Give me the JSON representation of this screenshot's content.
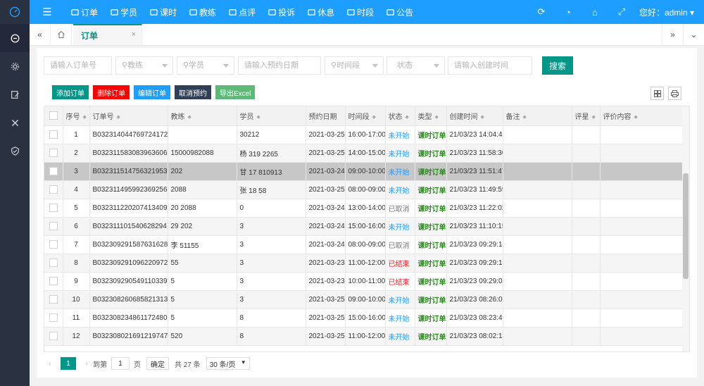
{
  "topnav": {
    "items": [
      {
        "icon": "tv-icon",
        "label": "订单"
      },
      {
        "icon": "users-icon",
        "label": "学员"
      },
      {
        "icon": "edit-icon",
        "label": "课时"
      },
      {
        "icon": "user-icon",
        "label": "教练"
      },
      {
        "icon": "thumb-icon",
        "label": "点评"
      },
      {
        "icon": "star-icon",
        "label": "投诉"
      },
      {
        "icon": "smile-icon",
        "label": "休息"
      },
      {
        "icon": "gear-icon",
        "label": "时段"
      },
      {
        "icon": "bell-icon",
        "label": "公告"
      }
    ],
    "greeting": "您好：admin"
  },
  "tabs": {
    "active": "订单"
  },
  "filters": {
    "order_no": "请输入订单号",
    "coach": "教练",
    "student": "学员",
    "date": "请输入预约日期",
    "timeslot": "时间段",
    "status": "状态",
    "created": "请输入创建时间",
    "search": "搜索"
  },
  "toolbar": {
    "add": "添加订单",
    "delete": "删除订单",
    "edit": "编辑订单",
    "cancel": "取消预约",
    "export": "导出Excel"
  },
  "colors": {
    "primary": "#009688",
    "blue": "#1e9fff",
    "red": "#ff0000",
    "dark": "#2f4056",
    "green": "#5fb878"
  },
  "table": {
    "headers": [
      "序号",
      "订单号",
      "教练",
      "学员",
      "预约日期",
      "时间段",
      "状态",
      "类型",
      "创建时间",
      "备注",
      "评星",
      "评价内容"
    ],
    "rows": [
      {
        "no": "1",
        "order": "B032314044769724172 5",
        "coach": "",
        "student": "30212",
        "date": "2021-03-25",
        "time": "16:00-17:00",
        "status": "未开始",
        "type": "课时订单",
        "created": "21/03/23 14:04:47"
      },
      {
        "no": "2",
        "order": "B032311583083963606 8",
        "coach": "15000982088",
        "student": "杨  319  2265",
        "date": "2021-03-25",
        "time": "14:00-15:00",
        "status": "未开始",
        "type": "课时订单",
        "created": "21/03/23 11:58:30"
      },
      {
        "no": "3",
        "order": "B032311514756321953 6",
        "coach": "202",
        "student": "甘  17  810913",
        "date": "2021-03-24",
        "time": "09:00-10:00",
        "status": "未开始",
        "type": "课时订单",
        "created": "21/03/23 11:51:47"
      },
      {
        "no": "4",
        "order": "B032311495992369256 0",
        "coach": "2088",
        "student": "张  18  58",
        "date": "2021-03-25",
        "time": "08:00-09:00",
        "status": "未开始",
        "type": "课时订单",
        "created": "21/03/23 11:49:59"
      },
      {
        "no": "5",
        "order": "B032311220207413409 5",
        "coach": "20  2088",
        "student": "0",
        "date": "2021-03-24",
        "time": "13:00-14:00",
        "status": "已取消",
        "type": "课时订单",
        "created": "21/03/23 11:22:02"
      },
      {
        "no": "6",
        "order": "B032311101540628294 2",
        "coach": "29  202",
        "student": "3",
        "date": "2021-03-24",
        "time": "15:00-16:00",
        "status": "未开始",
        "type": "课时订单",
        "created": "21/03/23 11:10:15"
      },
      {
        "no": "7",
        "order": "B032309291587631628 5",
        "coach": "李  51155",
        "student": "3",
        "date": "2021-03-24",
        "time": "08:00-09:00",
        "status": "已取消",
        "type": "课时订单",
        "created": "21/03/23 09:29:15"
      },
      {
        "no": "8",
        "order": "B032309291096220972 4",
        "coach": "55",
        "student": "3",
        "date": "2021-03-23",
        "time": "11:00-12:00",
        "status": "已结束",
        "type": "课时订单",
        "created": "21/03/23 09:29:10"
      },
      {
        "no": "9",
        "order": "B032309290549110339 7",
        "coach": "5",
        "student": "3",
        "date": "2021-03-23",
        "time": "10:00-11:00",
        "status": "已结束",
        "type": "课时订单",
        "created": "21/03/23 09:29:05"
      },
      {
        "no": "10",
        "order": "B032308260685821313 4",
        "coach": "5",
        "student": "3",
        "date": "2021-03-25",
        "time": "09:00-10:00",
        "status": "未开始",
        "type": "课时订单",
        "created": "21/03/23 08:26:06"
      },
      {
        "no": "11",
        "order": "B032308234861172480 8",
        "coach": "5",
        "student": "8",
        "date": "2021-03-25",
        "time": "15:00-16:00",
        "status": "未开始",
        "type": "课时订单",
        "created": "21/03/23 08:23:48"
      },
      {
        "no": "12",
        "order": "B032308021691219747 4",
        "coach": "520",
        "student": "8",
        "date": "2021-03-25",
        "time": "11:00-12:00",
        "status": "未开始",
        "type": "课时订单",
        "created": "21/03/23 08:02:16"
      }
    ]
  },
  "pager": {
    "current": "1",
    "goto_label": "到第",
    "goto_value": "1",
    "page_unit": "页",
    "confirm": "确定",
    "total": "共 27 条",
    "page_size": "30 条/页"
  }
}
